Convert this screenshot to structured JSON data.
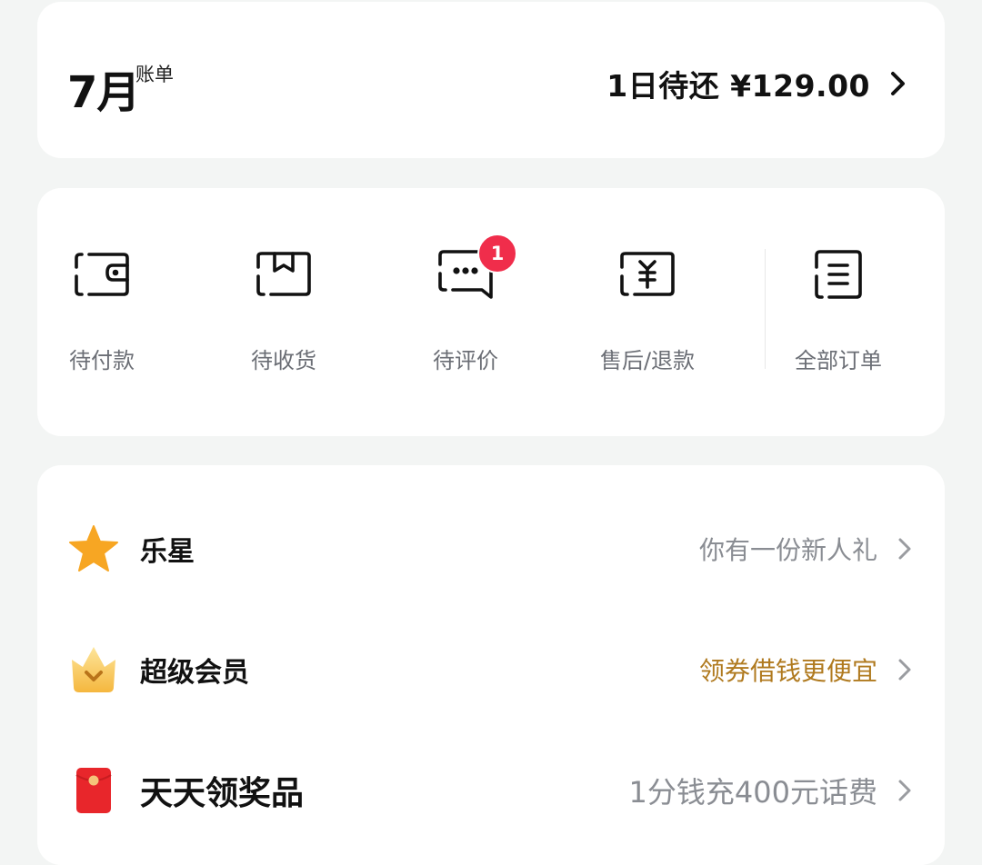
{
  "bill": {
    "month": "7月",
    "sup": "账单",
    "due_text": "1日待还 ¥129.00"
  },
  "orders": [
    {
      "label": "待付款",
      "icon": "wallet-icon"
    },
    {
      "label": "待收货",
      "icon": "package-icon"
    },
    {
      "label": "待评价",
      "icon": "comment-icon",
      "badge": "1"
    },
    {
      "label": "售后/退款",
      "icon": "refund-icon"
    },
    {
      "label": "全部订单",
      "icon": "order-list-icon"
    }
  ],
  "services": [
    {
      "title": "乐星",
      "subtitle": "你有一份新人礼",
      "icon": "star-icon"
    },
    {
      "title": "超级会员",
      "subtitle": "领券借钱更便宜",
      "icon": "crown-icon"
    },
    {
      "title": "天天领奖品",
      "subtitle": "1分钱充400元话费",
      "icon": "red-envelope-icon"
    }
  ],
  "colors": {
    "background": "#f3f5f4",
    "card": "#ffffff",
    "badge": "#f02d4b",
    "star": "#f7a623",
    "gold_text": "#b07a1f",
    "red_envelope": "#e8262b",
    "gray_text": "#8a8d93"
  }
}
